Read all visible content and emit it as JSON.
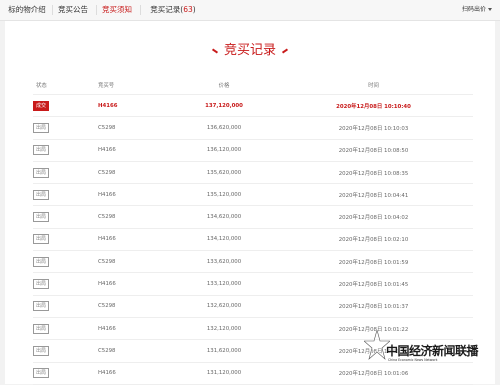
{
  "tabs": [
    {
      "label": "标的物介绍",
      "active": false
    },
    {
      "label": "竞买公告",
      "active": false
    },
    {
      "label": "竞买须知",
      "active": true
    },
    {
      "label": "竞买记录",
      "count": "63",
      "active": false
    }
  ],
  "tab_count_open": "(",
  "tab_count_close": ")",
  "scan_label": "扫码出价",
  "title": "竞买记录",
  "table": {
    "headers": [
      "状态",
      "竞买号",
      "价格",
      "时间"
    ],
    "rows": [
      {
        "status": "成交",
        "no": "H4166",
        "price": "137,120,000",
        "time": "2020年12月08日 10:10:40",
        "win": true
      },
      {
        "status": "出局",
        "no": "C5298",
        "price": "136,620,000",
        "time": "2020年12月08日 10:10:03",
        "win": false
      },
      {
        "status": "出局",
        "no": "H4166",
        "price": "136,120,000",
        "time": "2020年12月08日 10:08:50",
        "win": false
      },
      {
        "status": "出局",
        "no": "C5298",
        "price": "135,620,000",
        "time": "2020年12月08日 10:08:35",
        "win": false
      },
      {
        "status": "出局",
        "no": "H4166",
        "price": "135,120,000",
        "time": "2020年12月08日 10:04:41",
        "win": false
      },
      {
        "status": "出局",
        "no": "C5298",
        "price": "134,620,000",
        "time": "2020年12月08日 10:04:02",
        "win": false
      },
      {
        "status": "出局",
        "no": "H4166",
        "price": "134,120,000",
        "time": "2020年12月08日 10:02:10",
        "win": false
      },
      {
        "status": "出局",
        "no": "C5298",
        "price": "133,620,000",
        "time": "2020年12月08日 10:01:59",
        "win": false
      },
      {
        "status": "出局",
        "no": "H4166",
        "price": "133,120,000",
        "time": "2020年12月08日 10:01:45",
        "win": false
      },
      {
        "status": "出局",
        "no": "C5298",
        "price": "132,620,000",
        "time": "2020年12月08日 10:01:37",
        "win": false
      },
      {
        "status": "出局",
        "no": "H4166",
        "price": "132,120,000",
        "time": "2020年12月08日 10:01:22",
        "win": false
      },
      {
        "status": "出局",
        "no": "C5298",
        "price": "131,620,000",
        "time": "2020年12月08日 10:01:15",
        "win": false
      },
      {
        "status": "出局",
        "no": "H4166",
        "price": "131,120,000",
        "time": "2020年12月08日 10:01:06",
        "win": false
      }
    ]
  },
  "watermark": {
    "text": "中国经济新闻联播",
    "sub": "China Economic News Network"
  },
  "colors": {
    "accent": "#c81a1a",
    "panel": "#ffffff",
    "background": "#f2f2f2"
  }
}
